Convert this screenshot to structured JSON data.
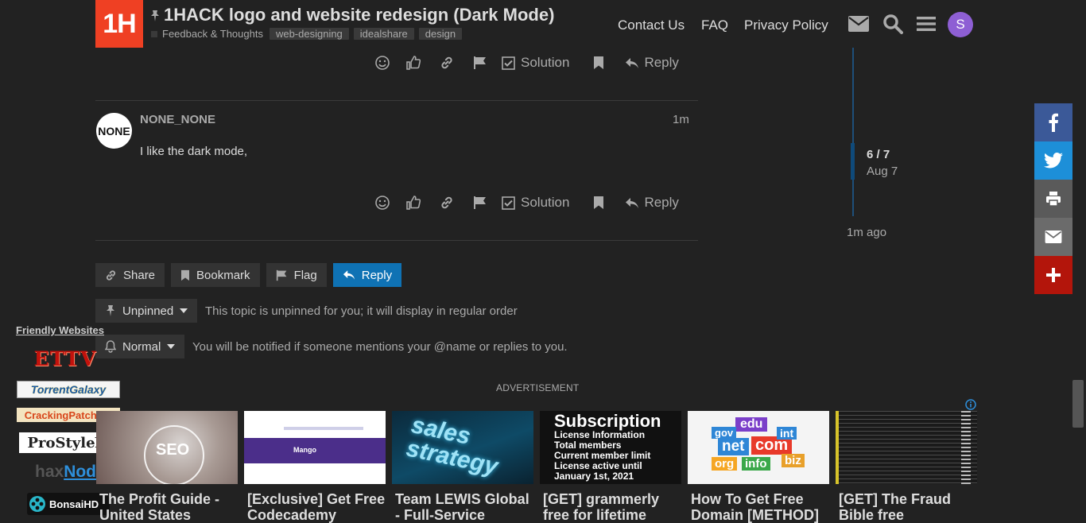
{
  "header": {
    "logo_text": "1H",
    "title": "1HACK logo and website redesign (Dark Mode)",
    "category": "Feedback & Thoughts",
    "tags": [
      "web-designing",
      "idealshare",
      "design"
    ],
    "links": [
      "Contact Us",
      "FAQ",
      "Privacy Policy"
    ],
    "avatar_letter": "S"
  },
  "post_actions": {
    "solution": "Solution",
    "reply": "Reply"
  },
  "post": {
    "avatar_text": "NONE",
    "username": "NONE_NONE",
    "time": "1m",
    "body": "I like the dark mode,"
  },
  "timeline": {
    "position": "6 / 7",
    "date": "Aug 7",
    "last": "1m ago"
  },
  "footer_buttons": {
    "share": "Share",
    "bookmark": "Bookmark",
    "flag": "Flag",
    "reply": "Reply"
  },
  "pin_notice": {
    "label": "Unpinned",
    "text": "This topic is unpinned for you; it will display in regular order"
  },
  "notification": {
    "label": "Normal",
    "text": "You will be notified if someone mentions your @name or replies to you."
  },
  "friendly": {
    "title": "Friendly Websites",
    "sites": [
      "ETTV",
      "TorrentGalaxy",
      "CrackingPatching",
      "ProStyleX",
      "hax",
      "Node",
      "BonsaiHD"
    ]
  },
  "ads": {
    "label": "ADVERTISEMENT",
    "items": [
      {
        "title": "The Profit Guide - United States",
        "img_text": "SEO"
      },
      {
        "title": "[Exclusive] Get Free Codecademy",
        "img_text": "Mango"
      },
      {
        "title": "Team LEWIS Global - Full-Service",
        "img_text": "sales strategy"
      },
      {
        "title": "[GET] grammerly free for lifetime",
        "img_text": "Subscription",
        "img_lines": [
          "License Information",
          "Total members",
          "Current member limit",
          "License active until",
          "January 1st, 2021"
        ]
      },
      {
        "title": "How To Get Free Domain [METHOD]",
        "img_text": "edu",
        "img_words": [
          "gov",
          "net",
          "com",
          "int",
          "org",
          "info",
          "biz"
        ]
      },
      {
        "title": "[GET] The Fraud Bible free",
        "img_text": ""
      }
    ]
  },
  "colors": {
    "logo": "#ef4023",
    "primary": "#0f72b4",
    "facebook": "#3b5998",
    "twitter": "#1da1f2",
    "plus": "#b3150b",
    "avatar": "#8e5fd4"
  }
}
